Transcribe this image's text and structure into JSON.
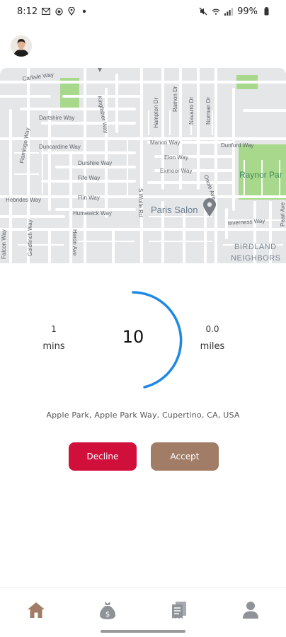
{
  "status_bar": {
    "time": "8:12",
    "left_icons": [
      "mail-icon",
      "record-icon",
      "location-icon",
      "dot-icon"
    ],
    "right_icons": [
      "mute-icon",
      "wifi-icon",
      "signal-icon"
    ],
    "battery": "99%"
  },
  "profile": {
    "avatar": "avatar"
  },
  "map": {
    "streets": [
      "Carlisle Way",
      "Dartshire Way",
      "Duncardine Way",
      "Durshire Way",
      "Fife Way",
      "Flin Way",
      "Humewick Way",
      "Hebrides Way",
      "Flamingo Way",
      "Kingfisher Way",
      "Hampton Dr",
      "Ramon Dr",
      "Navarro Dr",
      "Norman Dr",
      "Manon Way",
      "Dunford Way",
      "Elon Way",
      "Exmoor Way",
      "Oriole Ave",
      "Inverness Way",
      "S Wolfe Rd",
      "Heron Ave",
      "Goldfinch Way",
      "Falcon Way",
      "Pearl Ave"
    ],
    "poi": "Paris Salon",
    "park": "Raynor Par",
    "area_line1": "BIRDLAND",
    "area_line2": "NEIGHBORS",
    "colors": {
      "land": "#e4e6e7",
      "road": "#ffffff",
      "park": "#a8d88c",
      "pin": "#7a7f85"
    }
  },
  "trip": {
    "mins_value": "1",
    "mins_unit": "mins",
    "timer_value": "10",
    "miles_value": "0.0",
    "miles_unit": "miles",
    "timer_color": "#1e88e5",
    "address": "Apple Park, Apple Park Way, Cupertino, CA, USA"
  },
  "actions": {
    "decline_label": "Decline",
    "accept_label": "Accept",
    "decline_color": "#d0103a",
    "accept_color": "#a17d67"
  },
  "bottom_nav": [
    {
      "name": "home",
      "icon": "home-icon",
      "active": true
    },
    {
      "name": "earnings",
      "icon": "money-bag-icon",
      "active": false
    },
    {
      "name": "orders",
      "icon": "receipt-icon",
      "active": false
    },
    {
      "name": "profile",
      "icon": "person-icon",
      "active": false
    }
  ]
}
